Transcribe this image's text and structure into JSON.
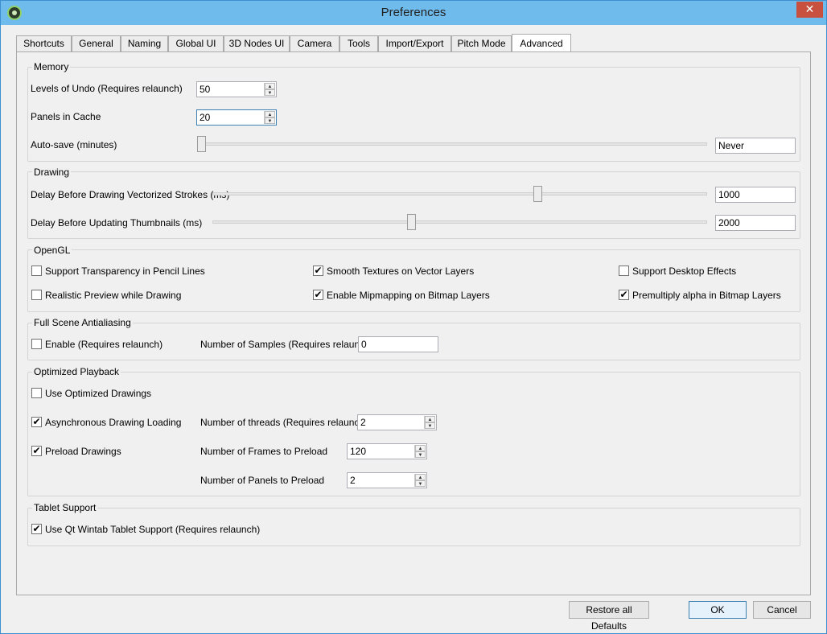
{
  "window": {
    "title": "Preferences",
    "close_glyph": "✕"
  },
  "tabs": [
    "Shortcuts",
    "General",
    "Naming",
    "Global UI",
    "3D Nodes UI",
    "Camera",
    "Tools",
    "Import/Export",
    "Pitch Mode",
    "Advanced"
  ],
  "active_tab": "Advanced",
  "memory": {
    "title": "Memory",
    "undo_label": "Levels of Undo (Requires relaunch)",
    "undo_value": "50",
    "cache_label": "Panels in Cache",
    "cache_value": "20",
    "autosave_label": "Auto-save (minutes)",
    "autosave_value": "Never",
    "autosave_position": 0.0
  },
  "drawing": {
    "title": "Drawing",
    "delay_label": "Delay Before Drawing Vectorized Strokes (ms)",
    "delay_value": "1000",
    "delay_position": 0.66,
    "thumb_label": "Delay Before Updating Thumbnails (ms)",
    "thumb_value": "2000",
    "thumb_position": 0.4
  },
  "opengl": {
    "title": "OpenGL",
    "transparency": {
      "label": "Support Transparency in Pencil Lines",
      "checked": false
    },
    "smooth": {
      "label": "Smooth Textures on Vector Layers",
      "checked": true
    },
    "desktop": {
      "label": "Support Desktop Effects",
      "checked": false
    },
    "realistic": {
      "label": "Realistic Preview while Drawing",
      "checked": false
    },
    "mipmap": {
      "label": "Enable Mipmapping on Bitmap Layers",
      "checked": true
    },
    "premult": {
      "label": "Premultiply alpha in Bitmap Layers",
      "checked": true
    }
  },
  "antialias": {
    "title": "Full Scene Antialiasing",
    "enable": {
      "label": "Enable (Requires relaunch)",
      "checked": false
    },
    "samples_label": "Number of Samples (Requires relaunch)",
    "samples_value": "0"
  },
  "playback": {
    "title": "Optimized Playback",
    "optimized": {
      "label": "Use Optimized Drawings",
      "checked": false
    },
    "async": {
      "label": "Asynchronous Drawing Loading",
      "checked": true
    },
    "preload": {
      "label": "Preload Drawings",
      "checked": true
    },
    "threads_label": "Number of threads (Requires relaunch)",
    "threads_value": "2",
    "frames_label": "Number of Frames to Preload",
    "frames_value": "120",
    "panels_label": "Number of Panels to Preload",
    "panels_value": "2"
  },
  "tablet": {
    "title": "Tablet Support",
    "wintab": {
      "label": "Use Qt Wintab Tablet Support (Requires relaunch)",
      "checked": true
    }
  },
  "buttons": {
    "restore": "Restore all Defaults",
    "ok": "OK",
    "cancel": "Cancel"
  },
  "icons": {
    "check": "✔",
    "up": "▲",
    "down": "▼"
  }
}
